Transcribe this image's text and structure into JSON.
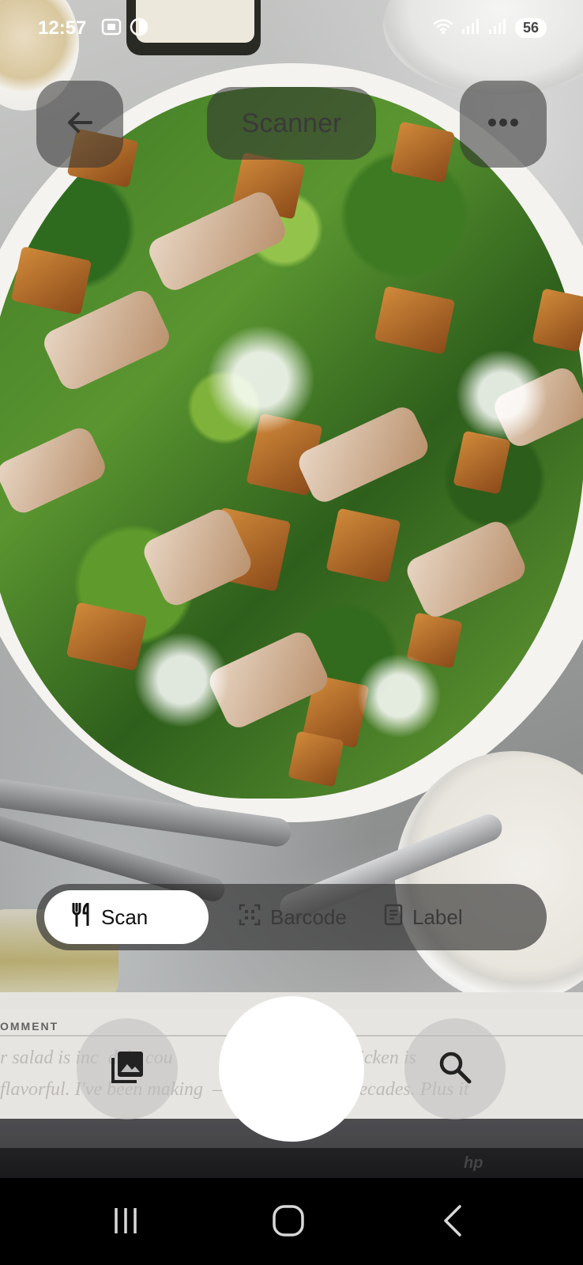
{
  "status_bar": {
    "time": "12:57",
    "battery": "56",
    "icons": [
      "screenshot-icon",
      "dark-mode-icon",
      "wifi-icon",
      "signal-icon",
      "signal-icon"
    ]
  },
  "app_bar": {
    "title": "Scanner",
    "back_icon": "back-arrow-icon",
    "menu_icon": "more-dots-icon"
  },
  "modes": [
    {
      "label": "Scan",
      "icon": "fork-knife-icon",
      "active": true
    },
    {
      "label": "Barcode",
      "icon": "barcode-scan-icon",
      "active": false
    },
    {
      "label": "Label",
      "icon": "label-document-icon",
      "active": false
    }
  ],
  "capture_bar": {
    "gallery_icon": "gallery-icon",
    "search_icon": "search-icon",
    "shutter_label": ""
  },
  "background": {
    "magazine_heading": "OMMENT",
    "magazine_line1": "r salad is inc  del   cou            ssing. And the chicken is",
    "magazine_line2": "flavorful. I've been making  —          salad for decades. Plus it",
    "laptop_logo": "hp"
  },
  "colors": {
    "active_pill": "#ffffff",
    "overlay": "#323232",
    "nav_bar": "#000000"
  }
}
